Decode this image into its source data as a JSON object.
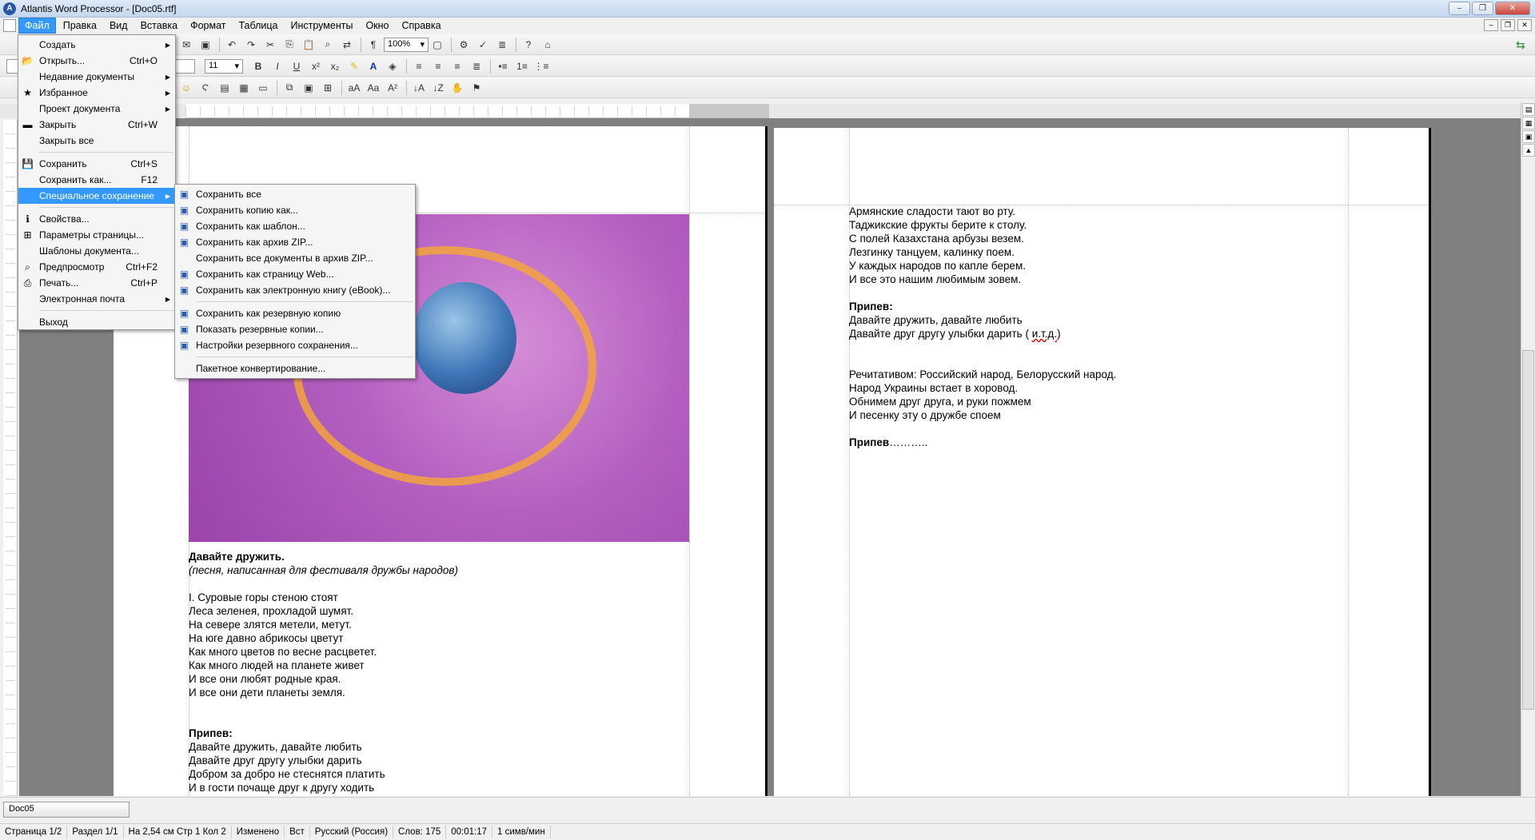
{
  "window": {
    "title": "Atlantis Word Processor - [Doc05.rtf]"
  },
  "menu": [
    "Файл",
    "Правка",
    "Вид",
    "Вставка",
    "Формат",
    "Таблица",
    "Инструменты",
    "Окно",
    "Справка"
  ],
  "toolbar": {
    "zoom": "100%",
    "font_size": "11"
  },
  "file_menu": {
    "items": [
      {
        "label": "Создать",
        "shortcut": "",
        "has_sub": true,
        "icon": ""
      },
      {
        "label": "Открыть...",
        "shortcut": "Ctrl+O",
        "has_sub": false,
        "icon": "open-folder-icon"
      },
      {
        "label": "Недавние документы",
        "shortcut": "",
        "has_sub": true,
        "icon": ""
      },
      {
        "label": "Избранное",
        "shortcut": "",
        "has_sub": true,
        "icon": "favorites-icon"
      },
      {
        "label": "Проект документа",
        "shortcut": "",
        "has_sub": true,
        "icon": ""
      },
      {
        "label": "Закрыть",
        "shortcut": "Ctrl+W",
        "has_sub": false,
        "icon": "close-doc-icon"
      },
      {
        "label": "Закрыть все",
        "shortcut": "",
        "has_sub": false,
        "icon": ""
      }
    ],
    "items2": [
      {
        "label": "Сохранить",
        "shortcut": "Ctrl+S",
        "has_sub": false,
        "icon": "save-icon"
      },
      {
        "label": "Сохранить как...",
        "shortcut": "F12",
        "has_sub": false,
        "icon": ""
      },
      {
        "label": "Специальное сохранение",
        "shortcut": "",
        "has_sub": true,
        "icon": "",
        "selected": true
      }
    ],
    "items3": [
      {
        "label": "Свойства...",
        "shortcut": "",
        "has_sub": false,
        "icon": "properties-icon"
      },
      {
        "label": "Параметры страницы...",
        "shortcut": "",
        "has_sub": false,
        "icon": "page-setup-icon"
      },
      {
        "label": "Шаблоны документа...",
        "shortcut": "",
        "has_sub": false,
        "icon": ""
      },
      {
        "label": "Предпросмотр",
        "shortcut": "Ctrl+F2",
        "has_sub": false,
        "icon": "preview-icon"
      },
      {
        "label": "Печать...",
        "shortcut": "Ctrl+P",
        "has_sub": false,
        "icon": "print-icon"
      },
      {
        "label": "Электронная почта",
        "shortcut": "",
        "has_sub": true,
        "icon": ""
      }
    ],
    "items4": [
      {
        "label": "Выход",
        "shortcut": "",
        "has_sub": false,
        "icon": ""
      }
    ]
  },
  "special_save_menu": {
    "group1": [
      "Сохранить все",
      "Сохранить копию как...",
      "Сохранить как шаблон...",
      "Сохранить как архив ZIP...",
      "Сохранить все документы в архив ZIP...",
      "Сохранить как страницу Web...",
      "Сохранить как электронную книгу (eBook)..."
    ],
    "group2": [
      "Сохранить как резервную копию",
      "Показать резервные копии...",
      "Настройки резервного сохранения..."
    ],
    "group3": [
      "Пакетное конвертирование..."
    ]
  },
  "page1": {
    "title": "Давайте дружить.",
    "subtitle": "(песня, написанная для фестиваля дружбы народов)",
    "verse1": [
      "I. Суровые горы стеною стоят",
      "Леса зеленея, прохладой шумят.",
      "На севере злятся метели, метут.",
      "На юге давно абрикосы цветут",
      "Как много цветов по весне расцветет.",
      "Как много людей на планете живет",
      "И все они любят родные края.",
      "И все они дети планеты земля."
    ],
    "chorus_label": "Припев:",
    "chorus": [
      "Давайте дружить, давайте любить",
      "Давайте друг другу улыбки дарить",
      "Добром за добро не стеснятся платить",
      "И в гости почаще друг к другу ходить"
    ]
  },
  "page2": {
    "verse": [
      "Армянские сладости тают во рту.",
      "Таджикские фрукты берите к столу.",
      "С полей Казахстана арбузы везем.",
      "Лезгинку танцуем, калинку поем.",
      "У каждых народов по капле берем.",
      "И все это нашим любимым зовем."
    ],
    "chorus_label": "Припев:",
    "chorus1": "Давайте дружить, давайте любить",
    "chorus2_pre": "Давайте друг другу улыбки дарить ( ",
    "chorus2_err": "и.т.д.",
    "chorus2_post": ")",
    "recit": [
      "Речитативом: Российский народ, Белорусский народ.",
      "Народ Украины встает в хоровод.",
      "Обнимем друг друга, и руки пожмем",
      "И песенку эту о дружбе споем"
    ],
    "end_label": "Припев",
    "end_dots": "……….."
  },
  "doc_tab": "Doc05",
  "status": [
    "Страница 1/2",
    "Раздел 1/1",
    "На 2,54 см  Стр 1  Кол 2",
    "Изменено",
    "Вст",
    "Русский (Россия)",
    "Слов: 175",
    "00:01:17",
    "1 симв/мин"
  ]
}
